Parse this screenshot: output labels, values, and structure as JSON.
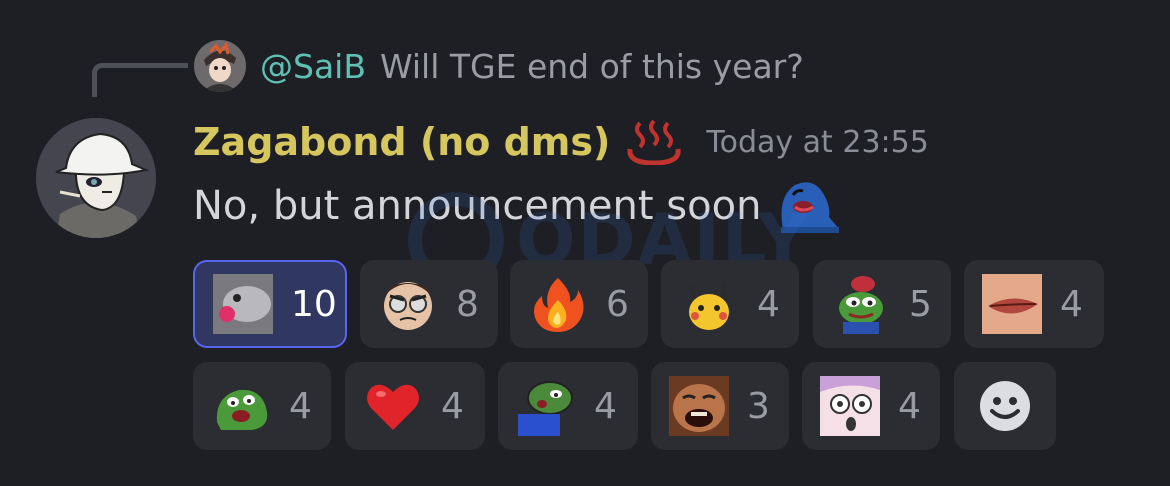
{
  "reply": {
    "username": "@SaiB",
    "text": "Will TGE end of this year?"
  },
  "message": {
    "author": "Zagabond (no dms)",
    "timestamp": "Today at 23:55",
    "text": "No, but announcement soon"
  },
  "watermark": {
    "text": "ODAILY"
  },
  "reactions": [
    {
      "emoji": "fish-kiss-icon",
      "count": "10",
      "active": true
    },
    {
      "emoji": "angry-glasses-face-icon",
      "count": "8"
    },
    {
      "emoji": "fire-icon",
      "count": "6"
    },
    {
      "emoji": "pikachu-icon",
      "count": "4"
    },
    {
      "emoji": "pepe-ham-icon",
      "count": "5"
    },
    {
      "emoji": "lips-icon",
      "count": "4"
    },
    {
      "emoji": "pepe-happy-icon",
      "count": "4"
    },
    {
      "emoji": "heart-icon",
      "count": "4"
    },
    {
      "emoji": "pepe-blue-icon",
      "count": "4"
    },
    {
      "emoji": "laughing-man-icon",
      "count": "3"
    },
    {
      "emoji": "anime-shocked-icon",
      "count": "4"
    }
  ],
  "colors": {
    "background": "#1e1f24",
    "username": "#d6c65e",
    "reply_user": "#5fc0b4",
    "active_border": "#5865f2"
  }
}
